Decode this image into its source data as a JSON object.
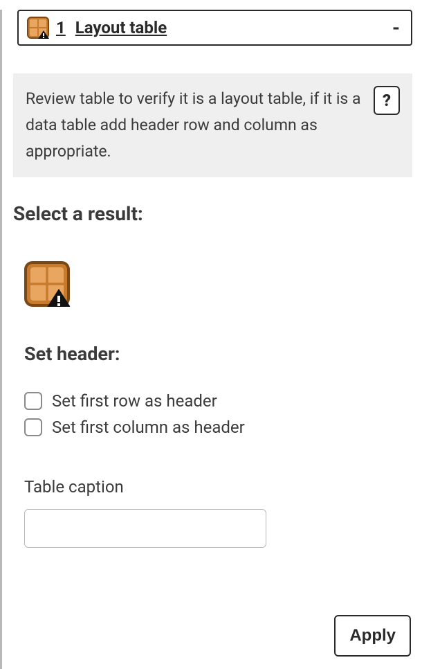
{
  "selector": {
    "item_number": "1",
    "title": "Layout table",
    "collapse_symbol": "-"
  },
  "description": {
    "text": "Review table to verify it is a layout table, if it is a data table add header row and column as appropriate.",
    "help_symbol": "?"
  },
  "headings": {
    "select_result": "Select a result:",
    "set_header": "Set header:"
  },
  "checks": {
    "row_header": "Set first row as header",
    "col_header": "Set first column as header"
  },
  "caption": {
    "label": "Table caption",
    "value": ""
  },
  "buttons": {
    "apply": "Apply"
  },
  "icon": {
    "name": "layout-table-warning-icon"
  }
}
